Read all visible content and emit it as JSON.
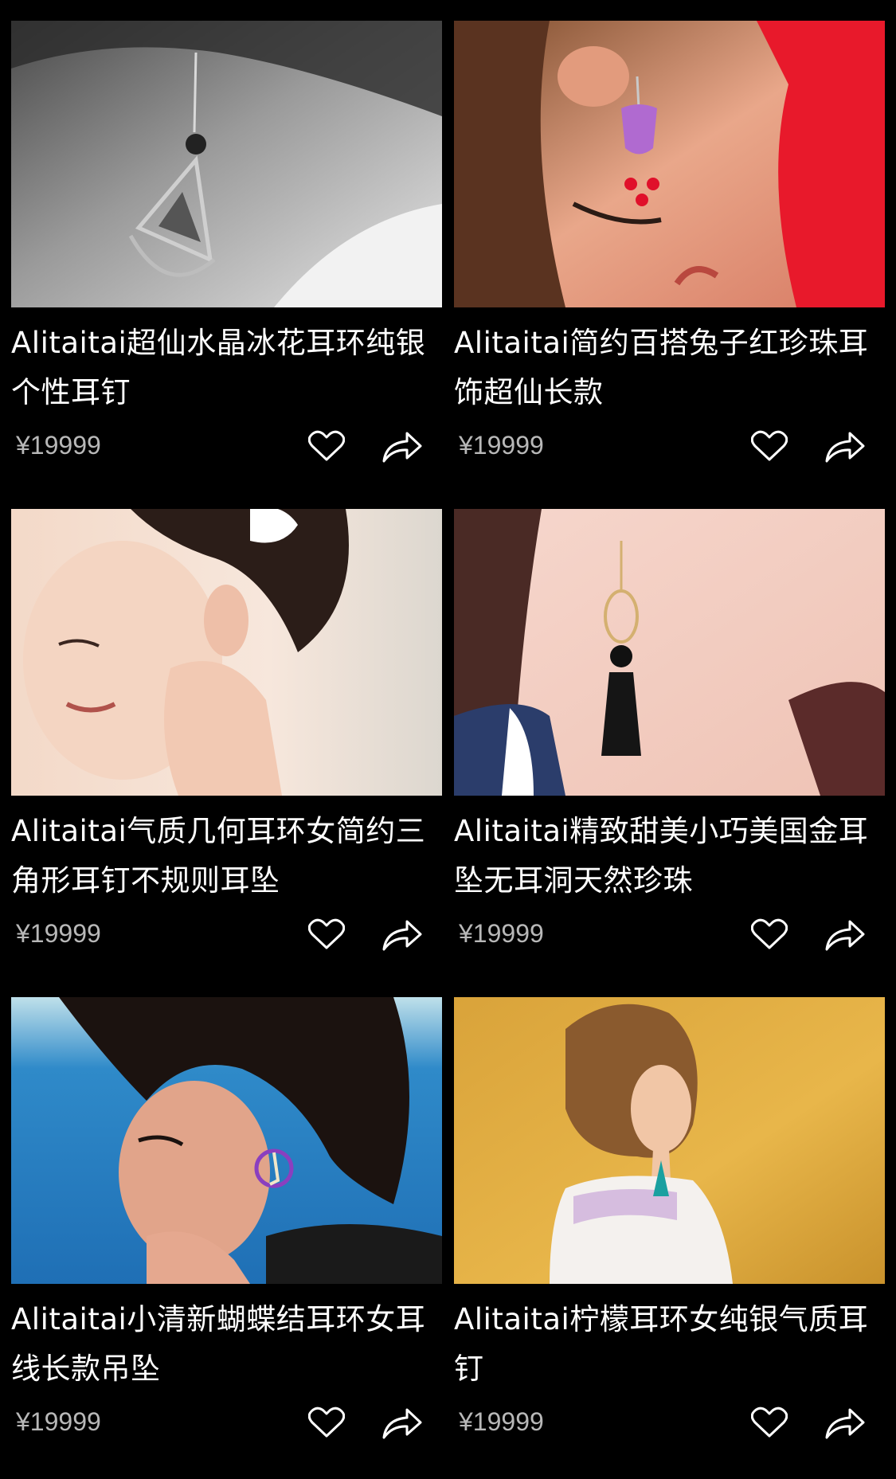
{
  "colors": {
    "background": "#000000",
    "title_text": "#ffffff",
    "price_text": "#b8b8b8",
    "icon_stroke": "#ffffff"
  },
  "products": [
    {
      "title": "Alitaitai超仙水晶冰花耳环纯银个性耳钉",
      "price": "¥19999",
      "image": "black-and-white photo of a crystal triangle drop earring",
      "like_icon": "heart-outline-icon",
      "share_icon": "share-arrow-icon"
    },
    {
      "title": "Alitaitai简约百搭兔子红珍珠耳饰超仙长款",
      "price": "¥19999",
      "image": "woman in red with a beaded pink-red dangling earring",
      "like_icon": "heart-outline-icon",
      "share_icon": "share-arrow-icon"
    },
    {
      "title": "Alitaitai气质几何耳环女简约三角形耳钉不规则耳坠",
      "price": "¥19999",
      "image": "smiling woman putting on an earring, white flower in hair",
      "like_icon": "heart-outline-icon",
      "share_icon": "share-arrow-icon"
    },
    {
      "title": "Alitaitai精致甜美小巧美国金耳坠无耳洞天然珍珠",
      "price": "¥19999",
      "image": "close-up of a gold hoop earring with black bead and black tassel",
      "like_icon": "heart-outline-icon",
      "share_icon": "share-arrow-icon"
    },
    {
      "title": "Alitaitai小清新蝴蝶结耳环女耳线长款吊坠",
      "price": "¥19999",
      "image": "woman with short hair by the blue sea wearing a round earring",
      "like_icon": "heart-outline-icon",
      "share_icon": "share-arrow-icon"
    },
    {
      "title": "Alitaitai柠檬耳环女纯银气质耳钉",
      "price": "¥19999",
      "image": "woman in profile against a yellow wall with teal tassel earring",
      "like_icon": "heart-outline-icon",
      "share_icon": "share-arrow-icon"
    }
  ]
}
